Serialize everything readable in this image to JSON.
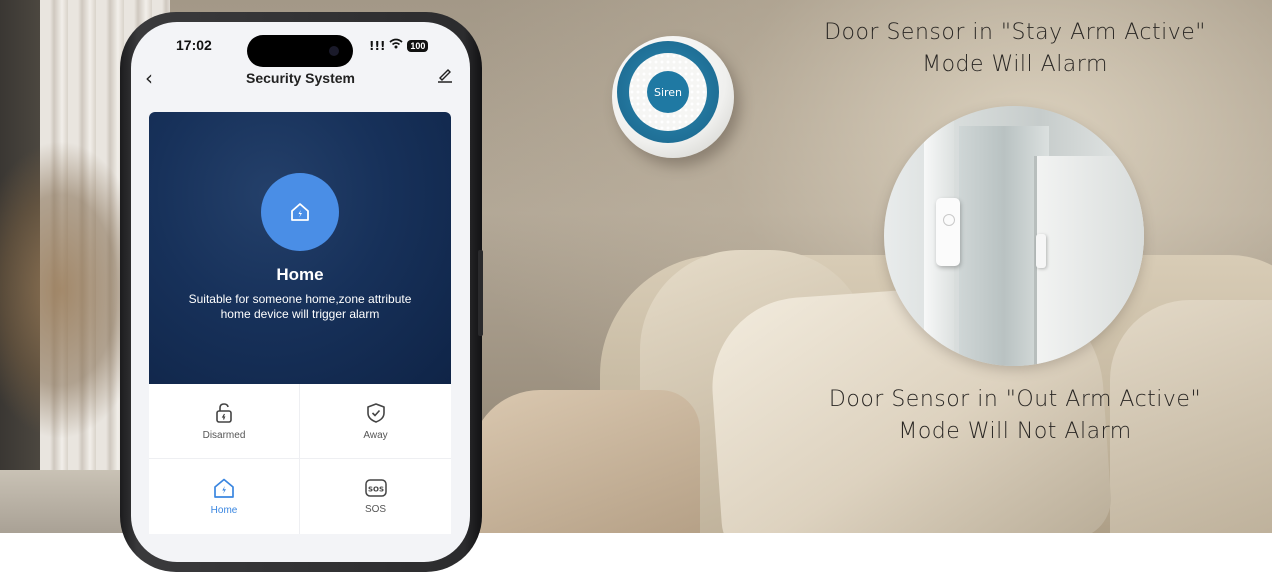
{
  "captions": {
    "top_line1": "Door Sensor in \"Stay Arm Active\"",
    "top_line2": "Mode Will Alarm",
    "bottom_line1": "Door Sensor in \"Out Arm Active\"",
    "bottom_line2": "Mode Will Not Alarm"
  },
  "siren": {
    "label": "Siren"
  },
  "phone": {
    "status": {
      "time": "17:02",
      "signal": "!!!",
      "wifi": "wifi-icon",
      "battery": "100"
    },
    "nav": {
      "back_icon": "chevron-left-icon",
      "title": "Security System",
      "edit_icon": "edit-icon"
    },
    "mode": {
      "icon": "home-shield-icon",
      "name": "Home",
      "description": "Suitable for someone home,zone attribute home device will trigger alarm"
    },
    "modes": [
      {
        "label": "Disarmed",
        "icon": "unlock-icon",
        "active": false
      },
      {
        "label": "Away",
        "icon": "shield-check-icon",
        "active": false
      },
      {
        "label": "Home",
        "icon": "home-icon",
        "active": true
      },
      {
        "label": "SOS",
        "icon": "sos-icon",
        "active": false
      }
    ]
  },
  "colors": {
    "accent": "#3a86e0",
    "hero_bg": "#17315a",
    "siren_ring": "#1f6f96"
  }
}
